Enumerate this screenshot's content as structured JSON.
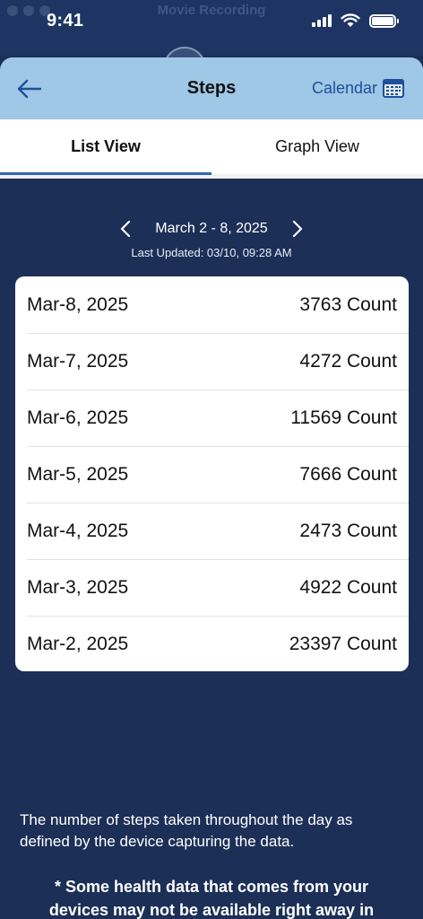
{
  "status_bar": {
    "time": "9:41",
    "recording_label": "Movie Recording"
  },
  "header": {
    "title": "Steps",
    "calendar_label": "Calendar"
  },
  "tabs": [
    {
      "label": "List View",
      "selected": true
    },
    {
      "label": "Graph View",
      "selected": false
    }
  ],
  "week": {
    "range": "March 2 - 8, 2025",
    "last_updated": "Last Updated:  03/10, 09:28 AM"
  },
  "entries": [
    {
      "date": "Mar-8, 2025",
      "count": "3763 Count"
    },
    {
      "date": "Mar-7, 2025",
      "count": "4272 Count"
    },
    {
      "date": "Mar-6, 2025",
      "count": "11569 Count"
    },
    {
      "date": "Mar-5, 2025",
      "count": "7666 Count"
    },
    {
      "date": "Mar-4, 2025",
      "count": "2473 Count"
    },
    {
      "date": "Mar-3, 2025",
      "count": "4922 Count"
    },
    {
      "date": "Mar-2, 2025",
      "count": "23397 Count"
    }
  ],
  "info_text": "The number of steps taken throughout the day as defined by the device capturing the data.",
  "note_text": "* Some health data that comes from your devices may not be available right away in",
  "colors": {
    "background": "#1c2f57",
    "header": "#9fc7e6",
    "accent": "#2f66b3",
    "link": "#1f4f9a"
  },
  "icons": {
    "back": "arrow-left-icon",
    "calendar": "calendar-icon",
    "prev": "chevron-left-icon",
    "next": "chevron-right-icon"
  }
}
